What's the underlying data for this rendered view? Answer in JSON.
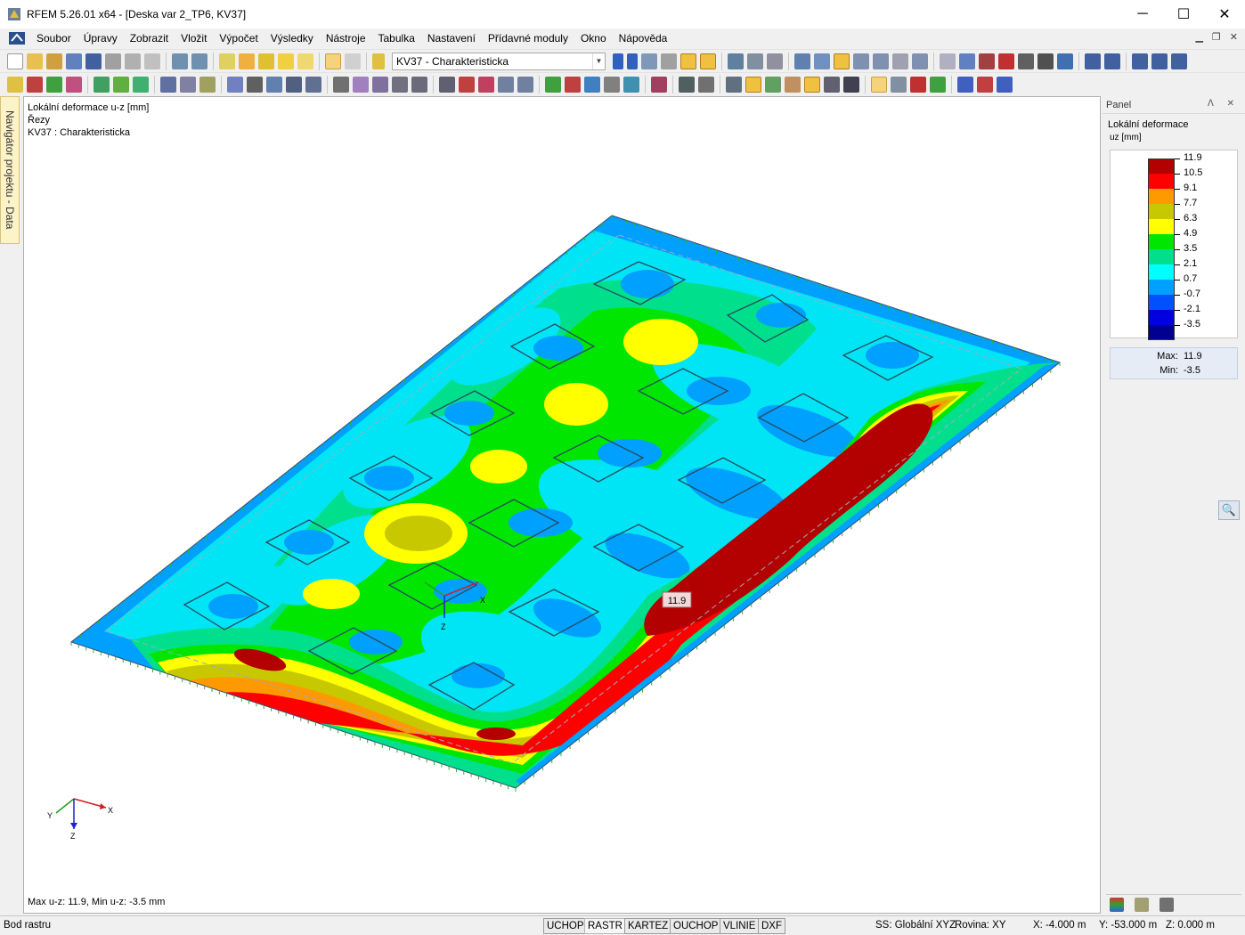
{
  "window": {
    "title": "RFEM 5.26.01 x64 - [Deska var 2_TP6, KV37]",
    "controls": {
      "minimize": "─",
      "maximize": "☐",
      "close": "✕"
    }
  },
  "menu": [
    "Soubor",
    "Úpravy",
    "Zobrazit",
    "Vložit",
    "Výpočet",
    "Výsledky",
    "Nástroje",
    "Tabulka",
    "Nastavení",
    "Přídavné moduly",
    "Okno",
    "Nápověda"
  ],
  "toolbar": {
    "load_case_combo": "KV37 - Charakteristicka",
    "combo_arrow": "▼"
  },
  "navigator_tab": "Navigátor projektu - Data",
  "viewport": {
    "info_lines": [
      "Lokální deformace u-z [mm]",
      "Řezy",
      "KV37 : Charakteristicka"
    ],
    "max_label": "11.9",
    "footer": "Max u-z: 11.9, Min u-z: -3.5 mm",
    "axes": {
      "x": "X",
      "y": "Y",
      "z": "Z"
    }
  },
  "panel": {
    "header": "Panel",
    "pin_icons": "ᐱ ✕",
    "title": "Lokální deformace",
    "unit": "uz [mm]",
    "legend": [
      {
        "value": "11.9",
        "color": "#b30000"
      },
      {
        "value": "10.5",
        "color": "#ff0000"
      },
      {
        "value": "9.1",
        "color": "#ff9900"
      },
      {
        "value": "7.7",
        "color": "#c8c800"
      },
      {
        "value": "6.3",
        "color": "#ffff00"
      },
      {
        "value": "4.9",
        "color": "#00e600"
      },
      {
        "value": "3.5",
        "color": "#00e08c"
      },
      {
        "value": "2.1",
        "color": "#00ffff"
      },
      {
        "value": "0.7",
        "color": "#00a0ff"
      },
      {
        "value": "-0.7",
        "color": "#0050ff"
      },
      {
        "value": "-2.1",
        "color": "#0000e0"
      },
      {
        "value": "-3.5",
        "color": "#000090"
      }
    ],
    "max_key": "Max:",
    "max_val": "11.9",
    "min_key": "Min:",
    "min_val": "-3.5"
  },
  "status": {
    "left": "Bod rastru",
    "buttons": [
      "UCHOP",
      "RASTR",
      "KARTEZ",
      "OUCHOP",
      "VLINIE",
      "DXF"
    ],
    "ss": "SS: Globální XYZ",
    "plane": "Rovina: XY",
    "x": "X: -4.000 m",
    "y": "Y: -53.000 m",
    "z": "Z: 0.000 m"
  }
}
